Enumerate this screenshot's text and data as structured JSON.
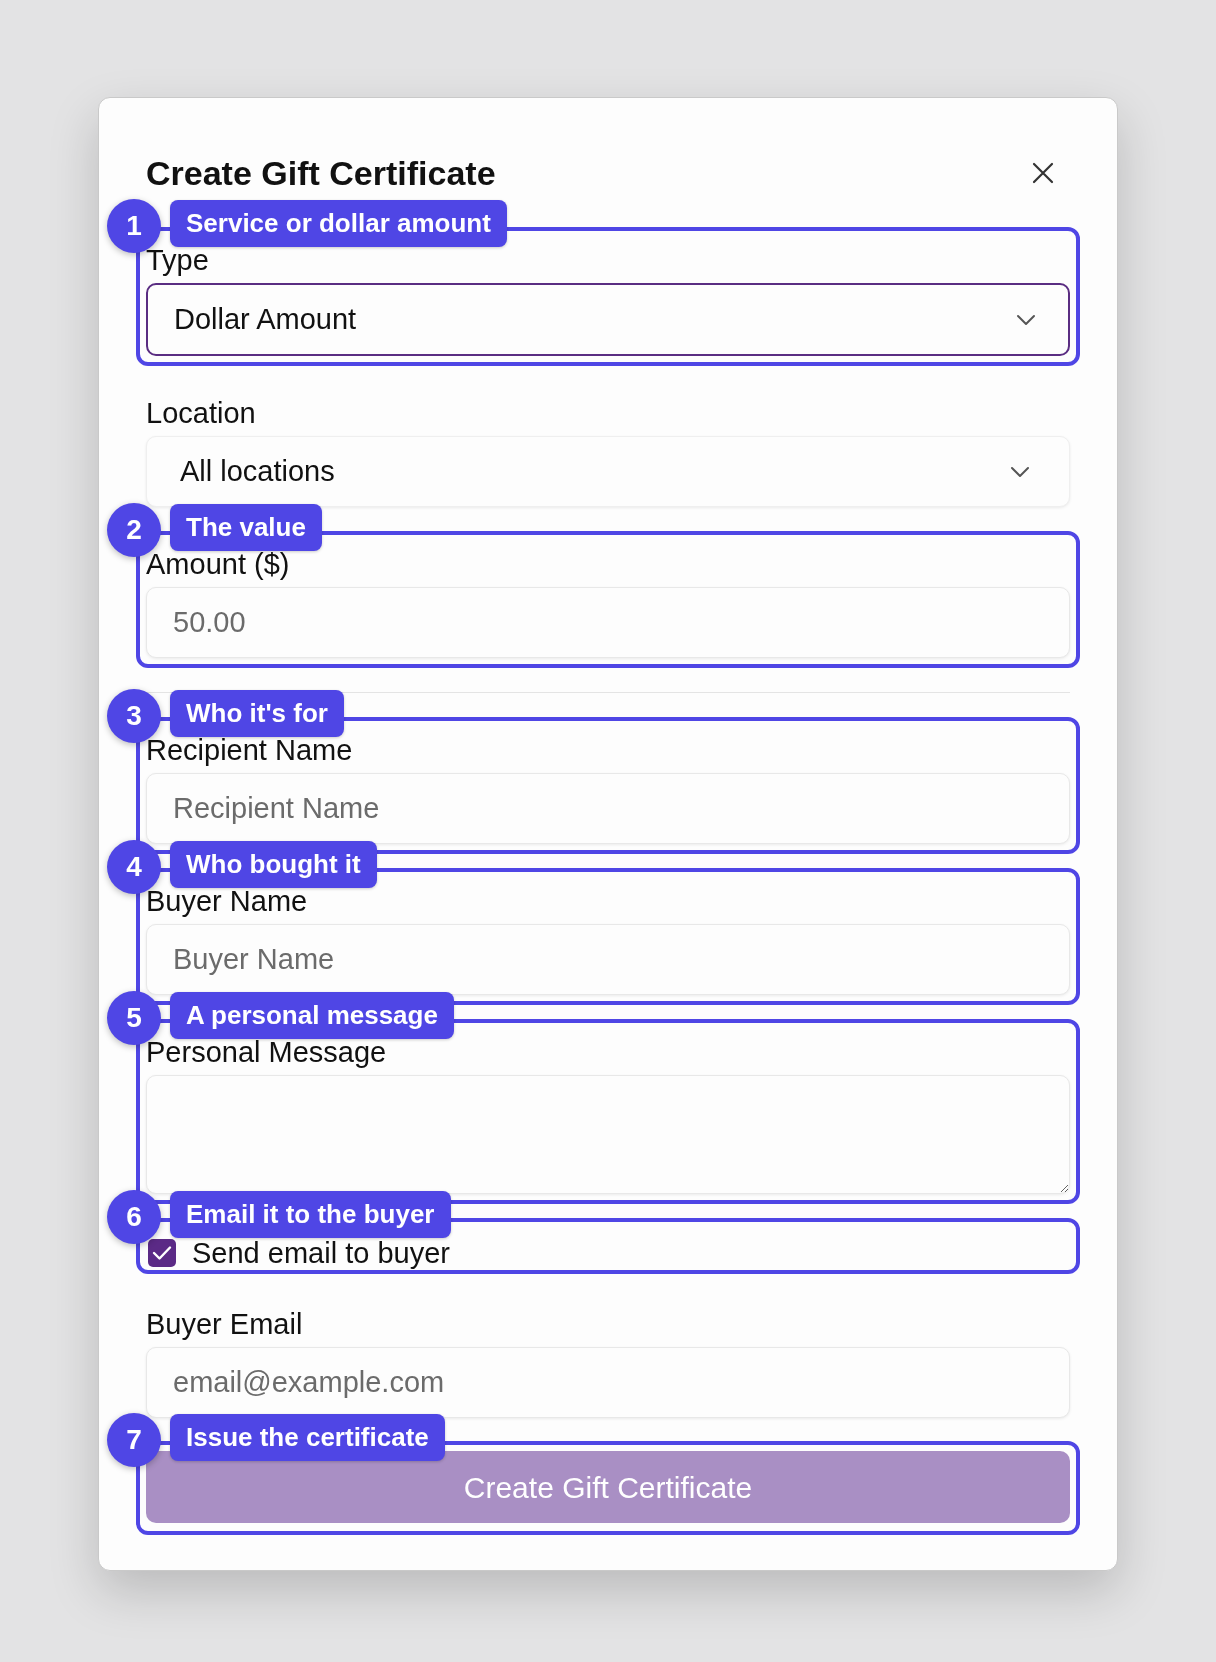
{
  "dialog": {
    "title": "Create Gift Certificate",
    "fields": [
      {
        "kind": "select",
        "label": "Type",
        "value": "Dollar Amount",
        "focused": true,
        "callout": {
          "number": "1",
          "text": "Service or dollar amount"
        }
      },
      {
        "kind": "select",
        "label": "Location",
        "value": "All locations",
        "focused": false
      },
      {
        "kind": "input",
        "label": "Amount ($)",
        "placeholder": "50.00",
        "callout": {
          "number": "2",
          "text": "The value"
        }
      },
      {
        "kind": "divider"
      },
      {
        "kind": "input",
        "label": "Recipient Name",
        "placeholder": "Recipient Name",
        "callout": {
          "number": "3",
          "text": "Who it's for"
        }
      },
      {
        "kind": "input",
        "label": "Buyer Name",
        "placeholder": "Buyer Name",
        "callout": {
          "number": "4",
          "text": "Who bought it"
        }
      },
      {
        "kind": "textarea",
        "label": "Personal Message",
        "callout": {
          "number": "5",
          "text": "A personal message"
        }
      },
      {
        "kind": "checkbox",
        "label": "Send email to buyer",
        "checked": true,
        "callout": {
          "number": "6",
          "text": "Email it to the buyer"
        }
      },
      {
        "kind": "input",
        "label": "Buyer Email",
        "placeholder": "email@example.com"
      },
      {
        "kind": "button",
        "label": "Create Gift Certificate",
        "disabled": true,
        "callout": {
          "number": "7",
          "text": "Issue the certificate"
        }
      }
    ]
  }
}
